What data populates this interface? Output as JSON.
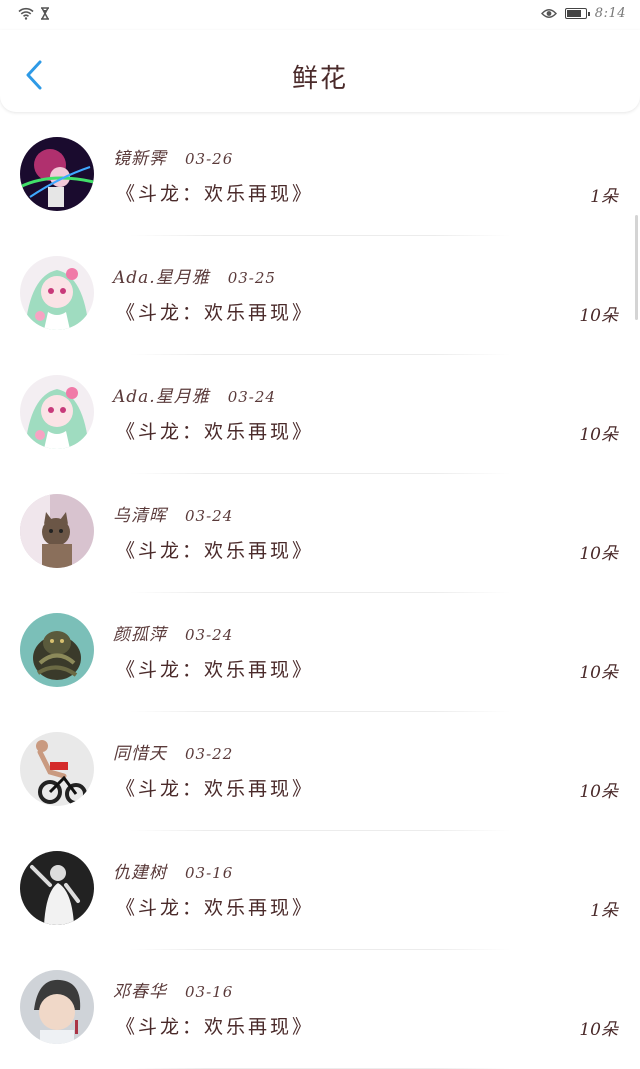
{
  "status_bar": {
    "time": "8:14",
    "icons": [
      "wifi-icon",
      "hourglass-icon",
      "eye-icon",
      "battery-icon"
    ],
    "battery_level": 0.9
  },
  "header": {
    "title": "鲜花",
    "back_icon": "chevron-left-icon"
  },
  "colors": {
    "accent": "#2e9ae6",
    "text": "#4a2a2a",
    "background": "#ffffff"
  },
  "items": [
    {
      "name": "镜新霁",
      "date": "03-26",
      "book": "《斗龙：欢乐再现》",
      "count": "1朵",
      "avatar": "avatar-neon-portrait"
    },
    {
      "name": "Ada.星月雅",
      "date": "03-25",
      "book": "《斗龙：欢乐再现》",
      "count": "10朵",
      "avatar": "avatar-anime-girl"
    },
    {
      "name": "Ada.星月雅",
      "date": "03-24",
      "book": "《斗龙：欢乐再现》",
      "count": "10朵",
      "avatar": "avatar-anime-girl"
    },
    {
      "name": "乌清晖",
      "date": "03-24",
      "book": "《斗龙：欢乐再现》",
      "count": "10朵",
      "avatar": "avatar-cat"
    },
    {
      "name": "颜孤萍",
      "date": "03-24",
      "book": "《斗龙：欢乐再现》",
      "count": "10朵",
      "avatar": "avatar-dragon-statue"
    },
    {
      "name": "同惜天",
      "date": "03-22",
      "book": "《斗龙：欢乐再现》",
      "count": "10朵",
      "avatar": "avatar-cyclist"
    },
    {
      "name": "仇建树",
      "date": "03-16",
      "book": "《斗龙：欢乐再现》",
      "count": "1朵",
      "avatar": "avatar-dancer-bw"
    },
    {
      "name": "邓春华",
      "date": "03-16",
      "book": "《斗龙：欢乐再现》",
      "count": "10朵",
      "avatar": "avatar-boy-portrait"
    }
  ]
}
